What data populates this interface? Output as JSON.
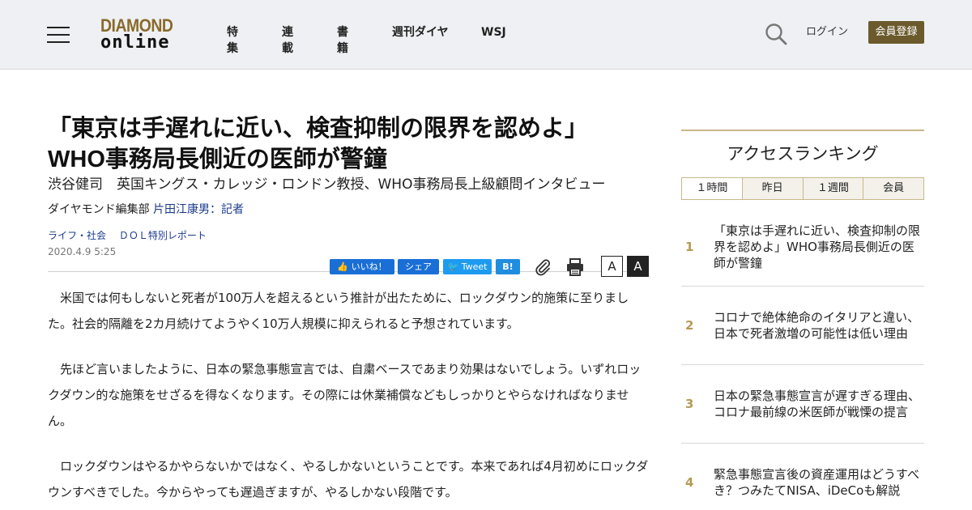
{
  "header": {
    "logo_top": "DIAMOND",
    "logo_bottom": "online",
    "nav": [
      "特集",
      "連載",
      "書籍",
      "週刊ダイヤ",
      "WSJ"
    ],
    "login": "ログイン",
    "register": "会員登録"
  },
  "article": {
    "title_line1": "「東京は手遅れに近い、検査抑制の限界を認めよ」",
    "title_line2": "WHO事務局長側近の医師が警鐘",
    "subtitle": "渋谷健司　英国キングス・カレッジ・ロンドン教授、WHO事務局長上級顧問インタビュー",
    "byline_prefix": "ダイヤモンド編集部",
    "byline_author": "片田江康男：記者",
    "categories": [
      "ライフ・社会",
      "ＤＯＬ特別レポート"
    ],
    "date": "2020.4.9 5:25",
    "share": {
      "like": "いいね！",
      "share": "シェア",
      "tweet": "Tweet",
      "hatena": "B!"
    },
    "font_small": "A",
    "font_large": "A",
    "paragraphs": [
      "米国では何もしないと死者が100万人を超えるという推計が出たために、ロックダウン的施策に至りました。社会的隔離を2カ月続けてようやく10万人規模に抑えられると予想されています。",
      "先ほど言いましたように、日本の緊急事態宣言では、自粛ベースであまり効果はないでしょう。いずれロックダウン的な施策をせざるを得なくなります。その際には休業補償などもしっかりとやらなければなりません。",
      "ロックダウンはやるかやらないかではなく、やるしかないということです。本来であれば4月初めにロックダウンすべきでした。今からやっても遅過ぎますが、やるしかない段階です。"
    ]
  },
  "ranking": {
    "heading": "アクセスランキング",
    "tabs": [
      "１時間",
      "昨日",
      "１週間",
      "会員"
    ],
    "items": [
      {
        "num": "1",
        "text": "「東京は手遅れに近い、検査抑制の限界を認めよ」WHO事務局長側近の医師が警鐘"
      },
      {
        "num": "2",
        "text": "コロナで絶体絶命のイタリアと違い、日本で死者激増の可能性は低い理由"
      },
      {
        "num": "3",
        "text": "日本の緊急事態宣言が遅すぎる理由、コロナ最前線の米医師が戦慄の提言"
      },
      {
        "num": "4",
        "text": "緊急事態宣言後の資産運用はどうすべき？つみたてNISA、iDeCoも解説"
      }
    ]
  },
  "colors": {
    "brand_gold": "#8a6a2a",
    "register_bg": "#6b5a2c",
    "link_blue": "#1a3a8a",
    "facebook_blue": "#1a6fd6",
    "twitter_blue": "#1d9bf0",
    "rank_gold": "#b49a55"
  }
}
